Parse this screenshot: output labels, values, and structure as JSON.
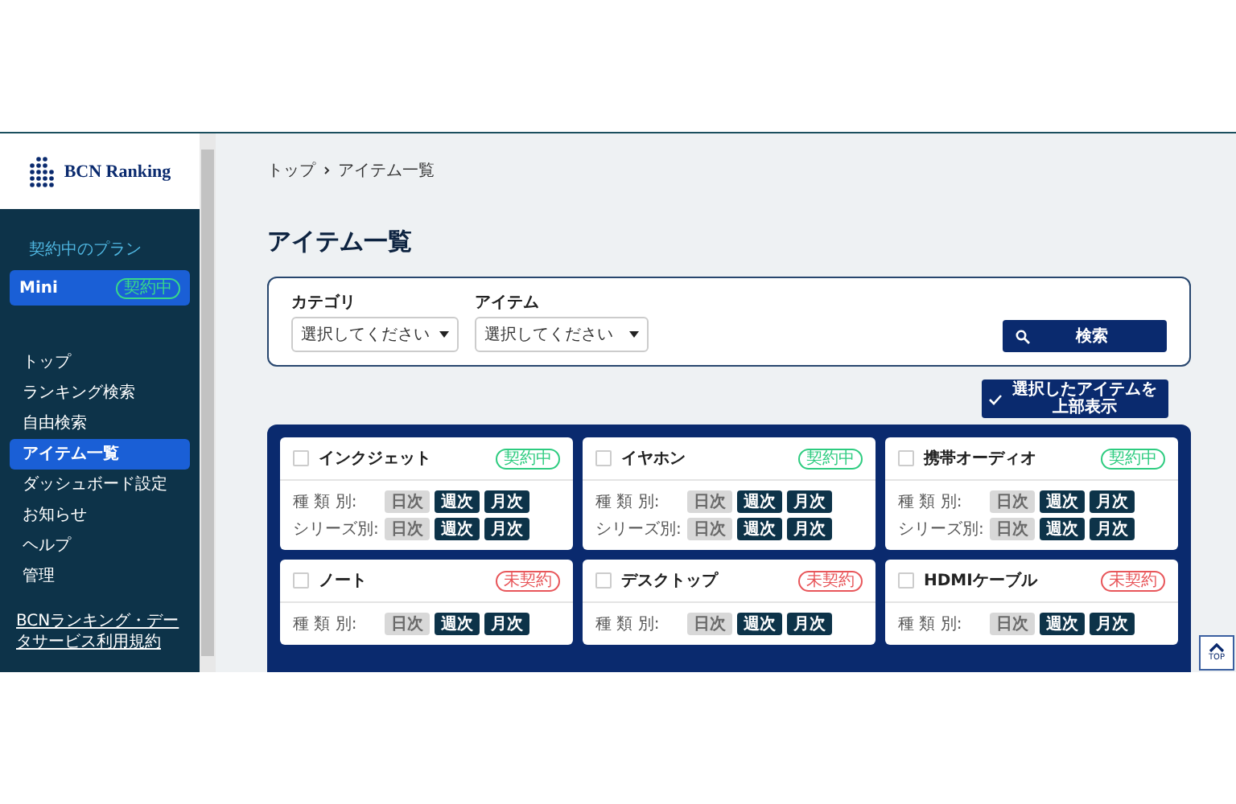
{
  "sidebar": {
    "logo": "BCN Ranking",
    "plan_label": "契約中のプラン",
    "plan": {
      "name": "Mini",
      "badge": "契約中"
    },
    "items": [
      {
        "label": "トップ",
        "selected": false
      },
      {
        "label": "ランキング検索",
        "selected": false
      },
      {
        "label": "自由検索",
        "selected": false
      },
      {
        "label": "アイテム一覧",
        "selected": true
      },
      {
        "label": "ダッシュボード設定",
        "selected": false
      },
      {
        "label": "お知らせ",
        "selected": false
      },
      {
        "label": "ヘルプ",
        "selected": false
      },
      {
        "label": "管理",
        "selected": false
      }
    ],
    "footer_link": "BCNランキング・データサービス利用規約"
  },
  "breadcrumb": [
    "トップ",
    "アイテム一覧"
  ],
  "page_title": "アイテム一覧",
  "filters": [
    {
      "label": "カテゴリ",
      "value": "選択してください"
    },
    {
      "label": "アイテム",
      "value": "選択してください"
    }
  ],
  "search_button": "検索",
  "show_selected_button": "選択したアイテムを上部表示",
  "cards": [
    {
      "title": "インクジェット",
      "checked": false,
      "badge": "契約中",
      "color": "#2ecc80",
      "rows": [
        {
          "label": "種 類 別:",
          "buttons": [
            {
              "label": "日次",
              "disabled": true
            },
            {
              "label": "週次",
              "disabled": false
            },
            {
              "label": "月次",
              "disabled": false
            }
          ]
        },
        {
          "label": "シリーズ別:",
          "buttons": [
            {
              "label": "日次",
              "disabled": true
            },
            {
              "label": "週次",
              "disabled": false
            },
            {
              "label": "月次",
              "disabled": false
            }
          ]
        }
      ]
    },
    {
      "title": "イヤホン",
      "checked": false,
      "badge": "契約中",
      "color": "#2ecc80",
      "rows": [
        {
          "label": "種 類 別:",
          "buttons": [
            {
              "label": "日次",
              "disabled": true
            },
            {
              "label": "週次",
              "disabled": false
            },
            {
              "label": "月次",
              "disabled": false
            }
          ]
        },
        {
          "label": "シリーズ別:",
          "buttons": [
            {
              "label": "日次",
              "disabled": true
            },
            {
              "label": "週次",
              "disabled": false
            },
            {
              "label": "月次",
              "disabled": false
            }
          ]
        }
      ]
    },
    {
      "title": "携帯オーディオ",
      "checked": false,
      "badge": "契約中",
      "color": "#2ecc80",
      "rows": [
        {
          "label": "種 類 別:",
          "buttons": [
            {
              "label": "日次",
              "disabled": true
            },
            {
              "label": "週次",
              "disabled": false
            },
            {
              "label": "月次",
              "disabled": false
            }
          ]
        },
        {
          "label": "シリーズ別:",
          "buttons": [
            {
              "label": "日次",
              "disabled": true
            },
            {
              "label": "週次",
              "disabled": false
            },
            {
              "label": "月次",
              "disabled": false
            }
          ]
        }
      ]
    },
    {
      "title": "ノート",
      "checked": false,
      "badge": "未契約",
      "color": "#e8565a",
      "rows": [
        {
          "label": "種 類 別:",
          "buttons": [
            {
              "label": "日次",
              "disabled": true
            },
            {
              "label": "週次",
              "disabled": false
            },
            {
              "label": "月次",
              "disabled": false
            }
          ]
        }
      ]
    },
    {
      "title": "デスクトップ",
      "checked": false,
      "badge": "未契約",
      "color": "#e8565a",
      "rows": [
        {
          "label": "種 類 別:",
          "buttons": [
            {
              "label": "日次",
              "disabled": true
            },
            {
              "label": "週次",
              "disabled": false
            },
            {
              "label": "月次",
              "disabled": false
            }
          ]
        }
      ]
    },
    {
      "title": "HDMIケーブル",
      "checked": false,
      "badge": "未契約",
      "color": "#e8565a",
      "rows": [
        {
          "label": "種 類 別:",
          "buttons": [
            {
              "label": "日次",
              "disabled": true
            },
            {
              "label": "週次",
              "disabled": false
            },
            {
              "label": "月次",
              "disabled": false
            }
          ]
        }
      ]
    }
  ],
  "top_button": "TOP"
}
